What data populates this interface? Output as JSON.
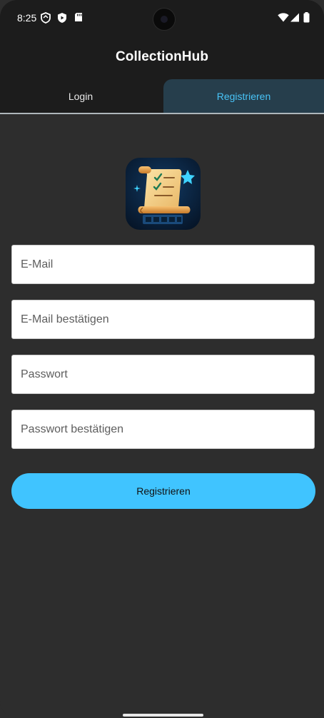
{
  "status_bar": {
    "time": "8:25"
  },
  "app": {
    "title": "CollectionHub"
  },
  "tabs": [
    {
      "label": "Login",
      "active": false
    },
    {
      "label": "Registrieren",
      "active": true
    }
  ],
  "form": {
    "email_placeholder": "E-Mail",
    "email_confirm_placeholder": "E-Mail bestätigen",
    "password_placeholder": "Passwort",
    "password_confirm_placeholder": "Passwort bestätigen",
    "submit_label": "Registrieren"
  },
  "colors": {
    "accent": "#40c4ff",
    "active_tab_bg": "#263e4c",
    "active_tab_text": "#48c4f8",
    "background": "#2d2d2d",
    "topbar": "#1c1c1c"
  },
  "icons": [
    "shield-icon",
    "play-protect-icon",
    "sd-card-icon",
    "wifi-icon",
    "signal-icon",
    "battery-icon",
    "camera-cutout",
    "app-logo-scroll-checklist"
  ]
}
